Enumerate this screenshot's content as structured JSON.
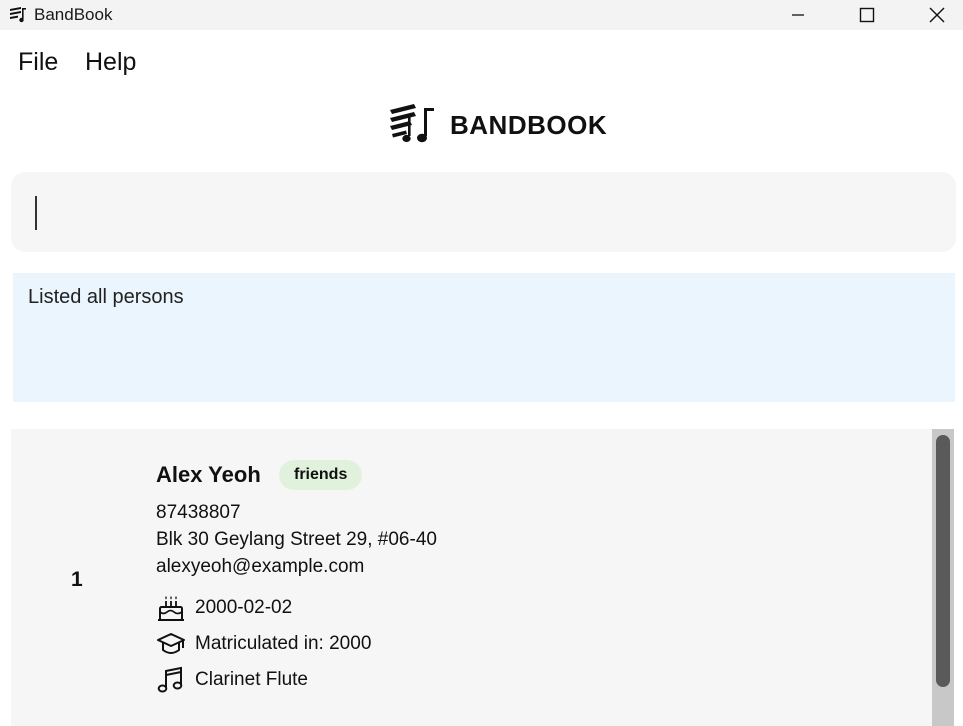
{
  "window": {
    "title": "BandBook",
    "app_icon": "bandbook-logo-icon",
    "controls": [
      "minimize-icon",
      "maximize-icon",
      "close-icon"
    ]
  },
  "menu": {
    "file_label": "File",
    "help_label": "Help"
  },
  "logo": {
    "text": "BANDBOOK",
    "icon": "bandbook-logo-icon"
  },
  "command_box": {
    "value": "",
    "placeholder": ""
  },
  "result_display": {
    "text": "Listed all persons"
  },
  "persons": [
    {
      "index": "1",
      "name": "Alex Yeoh",
      "tags": [
        "friends"
      ],
      "phone": "87438807",
      "address": "Blk 30 Geylang Street 29, #06-40",
      "email": "alexyeoh@example.com",
      "birthday": "2000-02-02",
      "birthday_icon": "birthday-cake-icon",
      "matriculation": "Matriculated in: 2000",
      "matriculation_icon": "graduation-cap-icon",
      "instruments": "Clarinet Flute",
      "instruments_icon": "music-note-icon"
    }
  ],
  "colors": {
    "titlebar_bg": "#f3f3f3",
    "command_bg": "#f6f6f6",
    "result_bg": "#eaf5fd",
    "tag_bg": "#e1f2dc",
    "list_bg": "#f6f6f6",
    "scroll_thumb": "#5a5a5a"
  }
}
